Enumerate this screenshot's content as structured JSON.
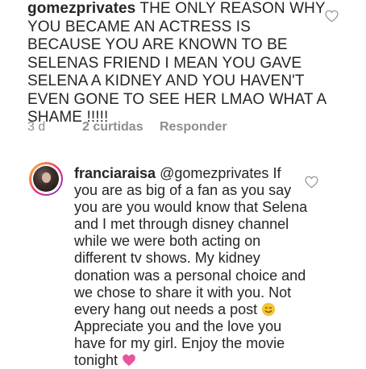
{
  "comments": [
    {
      "username": "gomezprivates",
      "text": "THE ONLY REASON WHY YOU BECAME AN ACTRESS IS BECAUSE YOU ARE KNOWN TO BE SELENAS FRIEND I MEAN YOU GAVE SELENA A KIDNEY AND YOU HAVEN'T EVEN GONE TO SEE HER LMAO WHAT A SHAME !!!!!",
      "time": "3 d",
      "likes": "2 curtidas",
      "reply": "Responder",
      "like_icon": "heart-outline-icon"
    },
    {
      "username": "franciaraisa",
      "mention": "@gomezprivates",
      "text_part1": "If you are as big of a fan as you say you are you would know that Selena and I met through disney channel while we were both acting on different tv shows. My kidney donation was a personal choice and we chose to share it with you. Not every hang out needs a post",
      "text_part2": "Appreciate you and the love you have for my girl. Enjoy the movie tonight",
      "emoji_1": "smiling-face-emoji",
      "emoji_2": "pink-heart-emoji",
      "like_icon": "heart-outline-icon",
      "avatar_icon": "profile-avatar"
    }
  ],
  "colors": {
    "text": "#262626",
    "meta": "#8e8e8e",
    "heart_outline": "#8e8e8e",
    "emoji_heart": "#e9559b",
    "emoji_face": "#f5c431"
  }
}
